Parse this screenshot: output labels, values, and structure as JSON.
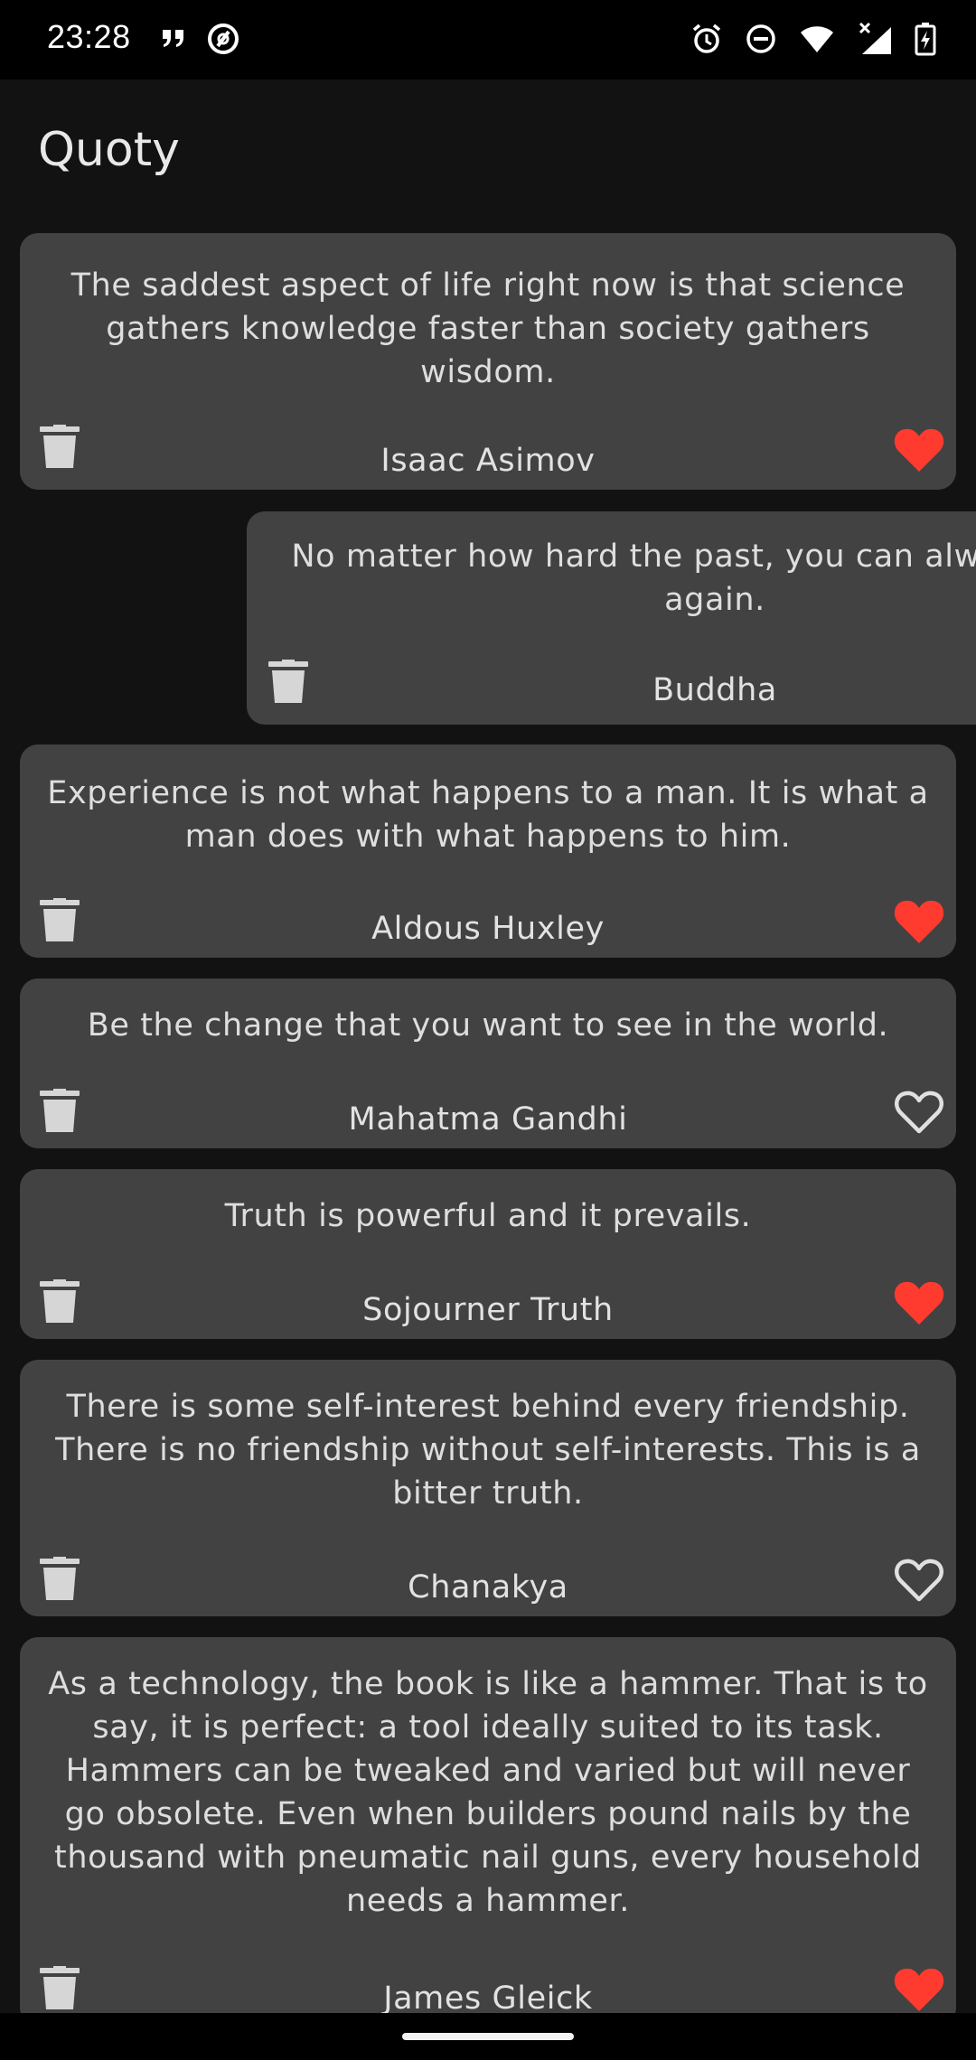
{
  "status_bar": {
    "time": "23:28",
    "left_icons": [
      "quote-mark-icon",
      "at-circle-icon"
    ],
    "right_icons": [
      "alarm-icon",
      "do-not-disturb-icon",
      "wifi-icon",
      "signal-no-service-icon",
      "battery-charging-icon"
    ]
  },
  "app": {
    "title": "Quoty"
  },
  "colors": {
    "background": "#121212",
    "card": "#424242",
    "heart_filled": "#ff3b30",
    "heart_outline": "#e0e0e0",
    "trash": "#d6d6d6"
  },
  "quotes": [
    {
      "text": "The saddest aspect of life right now is that science gathers knowledge faster than society gathers wisdom.",
      "author": "Isaac Asimov",
      "favorite": true
    },
    {
      "text": "No matter how hard the past, you can always begin again.",
      "author": "Buddha",
      "favorite": false
    },
    {
      "text": "Experience is not what happens to a man. It is what a man does with what happens to him.",
      "author": "Aldous Huxley",
      "favorite": true
    },
    {
      "text": "Be the change that you want to see in the world.",
      "author": "Mahatma Gandhi",
      "favorite": false
    },
    {
      "text": "Truth is powerful and it prevails.",
      "author": "Sojourner Truth",
      "favorite": true
    },
    {
      "text": "There is some self-interest behind every friendship. There is no friendship without self-interests. This is a bitter truth.",
      "author": "Chanakya",
      "favorite": false
    },
    {
      "text": "As a technology, the book is like a hammer. That is to say, it is perfect: a tool ideally suited to its task. Hammers can be tweaked and varied but will never go obsolete. Even when builders pound nails by the thousand with pneumatic nail guns, every household needs a hammer.",
      "author": "James Gleick",
      "favorite": true
    }
  ]
}
